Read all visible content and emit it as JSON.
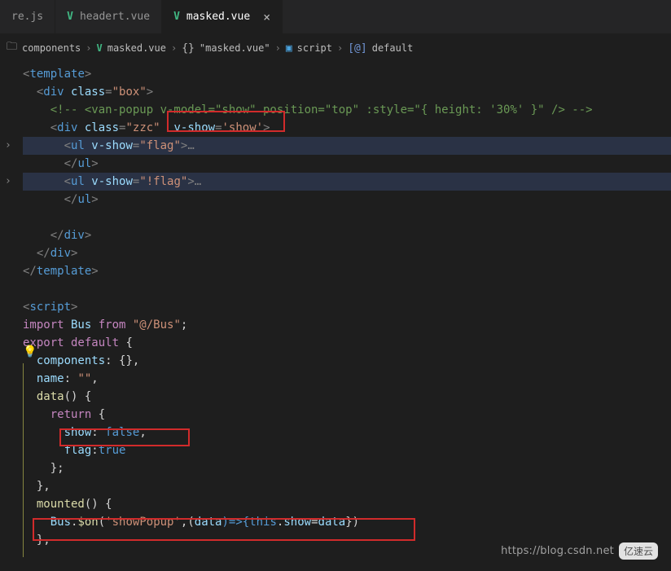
{
  "tabs": [
    {
      "label": "re.js",
      "kind": "js",
      "active": false
    },
    {
      "label": "headert.vue",
      "kind": "vue",
      "active": false
    },
    {
      "label": "masked.vue",
      "kind": "vue",
      "active": true
    }
  ],
  "breadcrumb": {
    "seg1": "components",
    "seg2": "masked.vue",
    "seg3": "\"masked.vue\"",
    "seg4": "script",
    "seg5": "default"
  },
  "code": {
    "l1": "<template>",
    "l2_open": "<",
    "l2_tag": "div",
    "l2_a1": " class",
    "l2_eq": "=",
    "l2_v1": "\"box\"",
    "l2_close": ">",
    "l3": "    <!-- <van-popup v-model=\"show\" position=\"top\" :style=\"{ height: '30%' }\" /> -->",
    "l4a": "<",
    "l4b": "div",
    "l4c": " class",
    "l4d": "=",
    "l4e": "\"zzc\"",
    "l4f": "  v-show",
    "l4g": "=",
    "l4h": "'show'",
    "l4i": ">",
    "l5a": "<",
    "l5b": "ul",
    "l5c": " v-show",
    "l5d": "=",
    "l5e": "\"flag\"",
    "l5f": ">",
    "l5dots": "…",
    "l6": "      </ul>",
    "l7a": "<",
    "l7b": "ul",
    "l7c": " v-show",
    "l7d": "=",
    "l7e": "\"!flag\"",
    "l7f": ">",
    "l7dots": "…",
    "l8": "      </ul>",
    "l9": "    </div>",
    "l10": "  </div>",
    "l11": "</template>",
    "l12": "",
    "l13_open": "<",
    "l13_tag": "script",
    "l13_close": ">",
    "l14_imp": "import",
    "l14_bus": " Bus ",
    "l14_from": "from",
    "l14_str": " \"@/Bus\"",
    "l14_semi": ";",
    "l15_exp": "export",
    "l15_def": " default",
    "l15_brace": " {",
    "l16_key": "  components",
    "l16_rest": ": {},",
    "l17_key": "  name",
    "l17_colon": ": ",
    "l17_val": "\"\"",
    "l17_comma": ",",
    "l18_key": "  data",
    "l18_paren": "()",
    "l18_brace": " {",
    "l19_ret": "    return",
    "l19_brace": " {",
    "l20_k": "      show",
    "l20_colon": ": ",
    "l20_v": "false",
    "l20_comma": ",",
    "l21_k": "      flag",
    "l21_colon": ":",
    "l21_v": "true",
    "l22": "    };",
    "l23": "  },",
    "l24_k": "  mounted",
    "l24_paren": "()",
    "l24_brace": " {",
    "l25_bus": "    Bus",
    "l25_dot1": ".",
    "l25_on": "$on",
    "l25_p1": "(",
    "l25_s1": "'showPopup'",
    "l25_c": ",(",
    "l25_d": "data",
    "l25_arr": ")=>{",
    "l25_this": "this",
    "l25_dot2": ".",
    "l25_show": "show",
    "l25_eq": "=",
    "l25_data": "data",
    "l25_end": "})",
    "l26": "  },"
  },
  "watermark": {
    "url": "https://blog.csdn.net",
    "brand": "亿速云"
  }
}
